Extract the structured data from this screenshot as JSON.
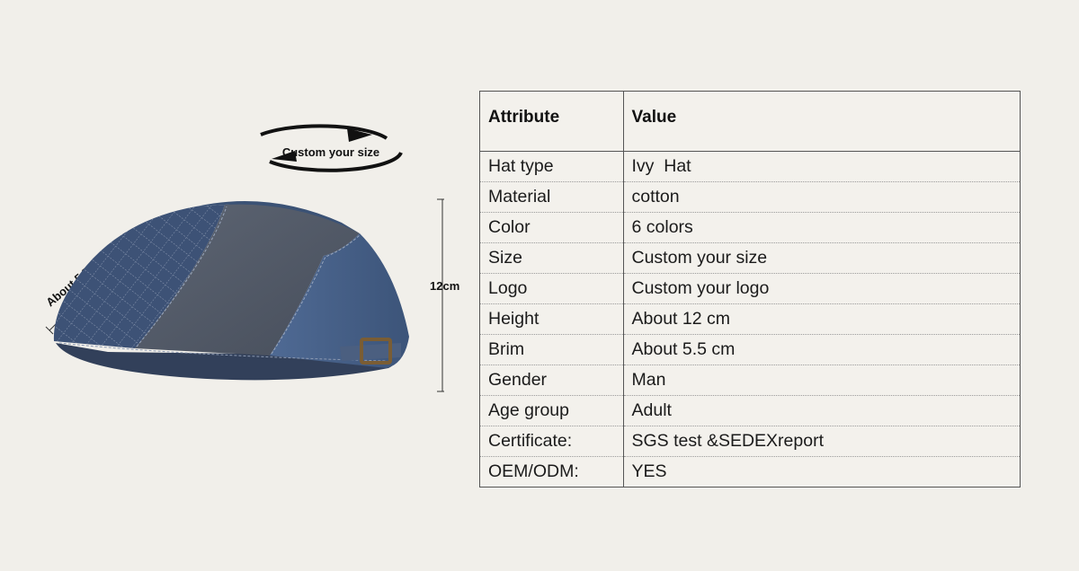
{
  "annotations": {
    "circle_label": "Custom your size",
    "height_label": "12cm",
    "brim_label": "About 5.5cm"
  },
  "spec_table": {
    "headers": [
      "Attribute",
      "Value"
    ],
    "rows": [
      [
        "Hat type",
        "Ivy  Hat"
      ],
      [
        "Material",
        "cotton"
      ],
      [
        "Color",
        "6 colors"
      ],
      [
        "Size",
        "Custom your size"
      ],
      [
        "Logo",
        "Custom your logo"
      ],
      [
        "Height",
        "About 12 cm"
      ],
      [
        "Brim",
        "About 5.5 cm"
      ],
      [
        "Gender",
        "Man"
      ],
      [
        "Age group",
        "Adult"
      ],
      [
        "Certificate:",
        "SGS test &SEDEXreport"
      ],
      [
        "OEM/ODM:",
        "YES"
      ]
    ]
  }
}
